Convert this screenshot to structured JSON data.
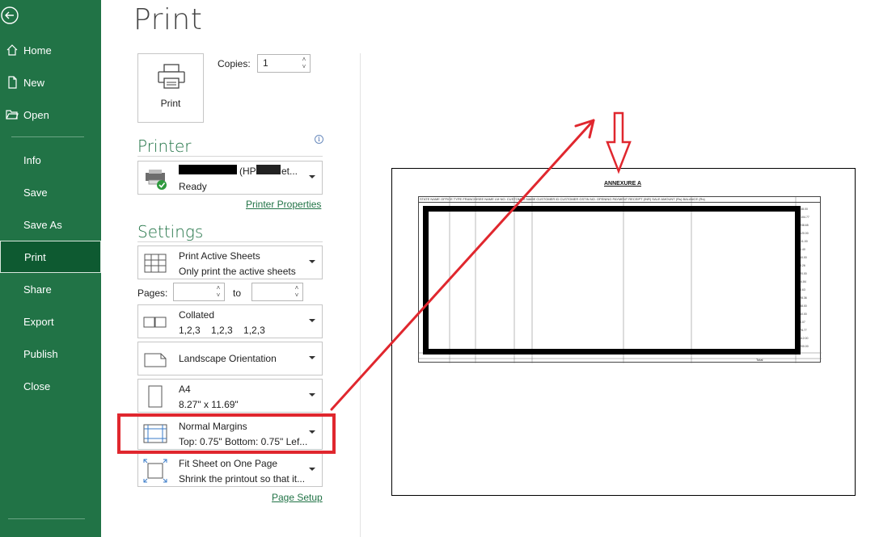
{
  "sidebar": {
    "top_items": [
      {
        "label": "Home",
        "icon": "home-icon"
      },
      {
        "label": "New",
        "icon": "new-document-icon"
      },
      {
        "label": "Open",
        "icon": "folder-open-icon"
      }
    ],
    "items": [
      {
        "label": "Info"
      },
      {
        "label": "Save"
      },
      {
        "label": "Save As"
      },
      {
        "label": "Print",
        "active": true
      },
      {
        "label": "Share"
      },
      {
        "label": "Export"
      },
      {
        "label": "Publish"
      },
      {
        "label": "Close"
      }
    ],
    "color": "#217346",
    "active_color": "#0e5a31"
  },
  "page": {
    "title": "Print"
  },
  "print": {
    "button_label": "Print",
    "copies_label": "Copies:",
    "copies_value": "1"
  },
  "printer": {
    "section_title": "Printer",
    "name_suffix": "(HP",
    "name_tail": "et...",
    "status": "Ready",
    "properties_link": "Printer Properties"
  },
  "settings": {
    "section_title": "Settings",
    "sheets": {
      "title": "Print Active Sheets",
      "subtitle": "Only print the active sheets"
    },
    "pages_label": "Pages:",
    "to_label": "to",
    "collation": {
      "title": "Collated",
      "subtitle": "1,2,3    1,2,3    1,2,3"
    },
    "orientation": {
      "title": "Landscape Orientation"
    },
    "paper": {
      "title": "A4",
      "subtitle": "8.27\" x 11.69\""
    },
    "margins": {
      "title": "Normal Margins",
      "subtitle": "Top: 0.75\" Bottom: 0.75\" Lef..."
    },
    "scaling": {
      "title": "Fit Sheet on One Page",
      "subtitle": "Shrink the printout so that it..."
    },
    "page_setup_link": "Page Setup"
  },
  "preview": {
    "annex_title": "ANNEXURE A",
    "header_text": "STATE NAME    OFFICE TYPE    FRANCHISEE NAME    LM NO.    CUSTOMER NAME    CUSTOMER ID    CUSTOMER GSTIN NO.    OPENING    PAYMENT RECEIPT (INR)    SALE AMOUNT (Rs)    BALANCE (Rs)",
    "total_label": "Total"
  },
  "annotation": {
    "highlight_color": "#e0272e"
  }
}
